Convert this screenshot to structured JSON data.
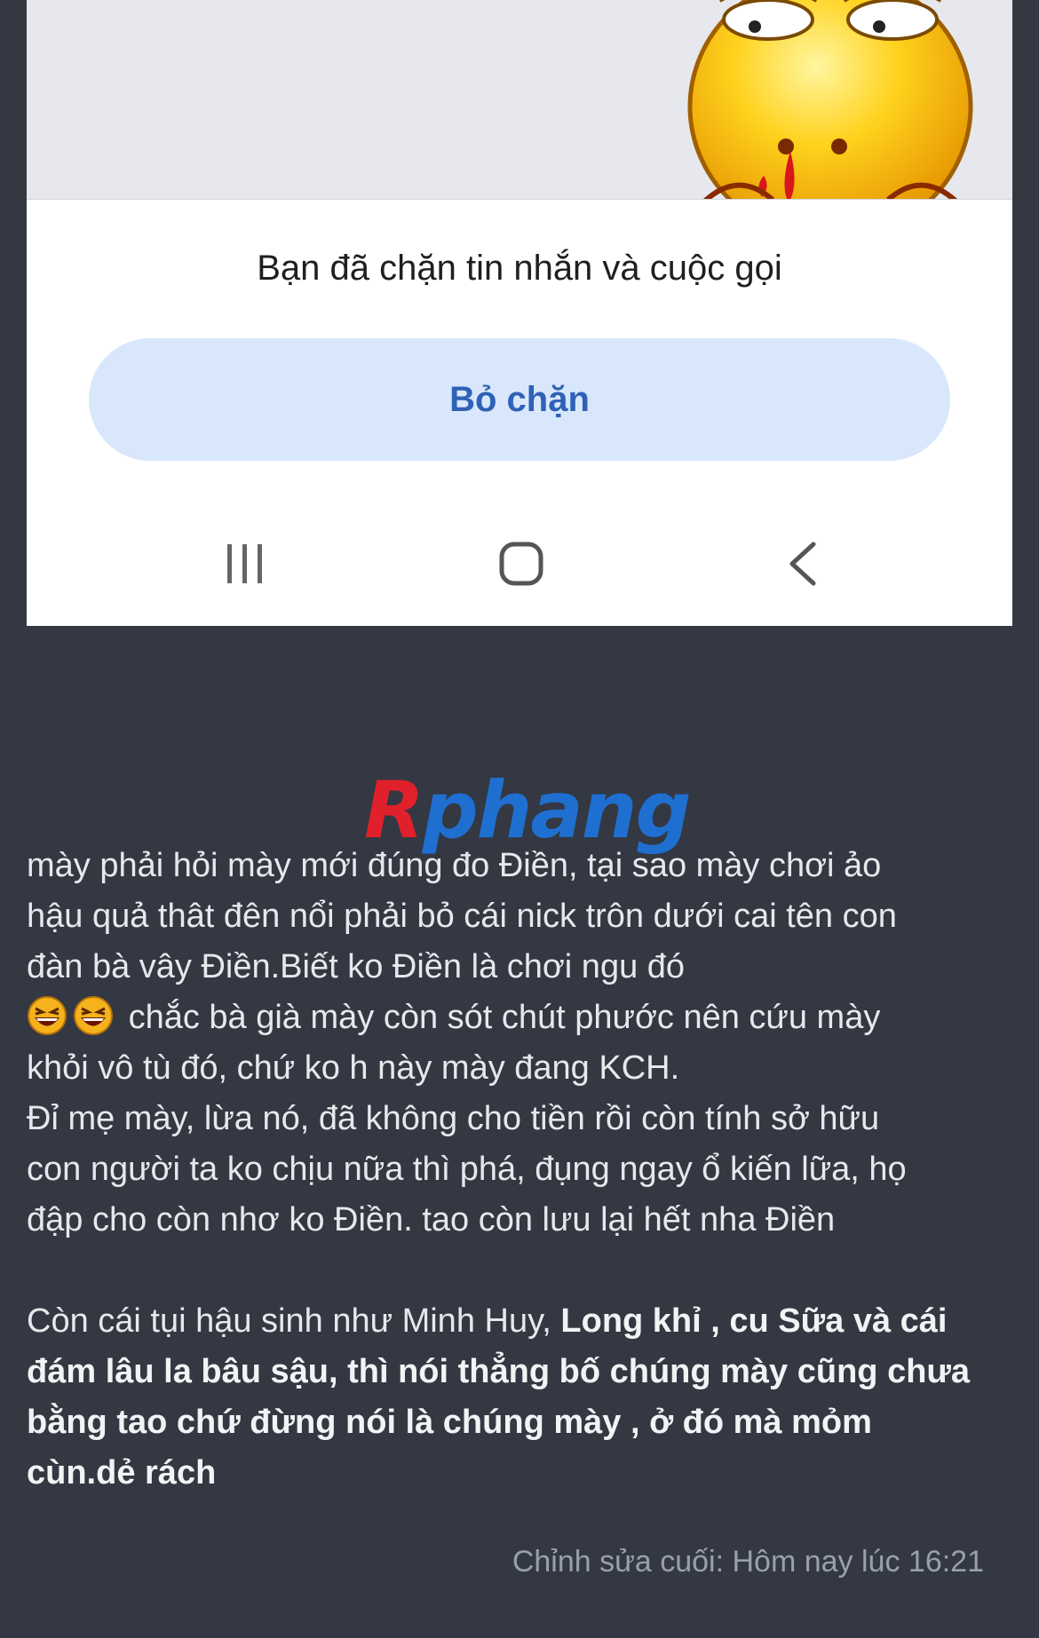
{
  "screenshot": {
    "blocked_message": "Bạn đã chặn tin nhắn và cuộc gọi",
    "unblock_label": "Bỏ chặn",
    "navbar": [
      "recents-icon",
      "home-icon",
      "back-icon"
    ]
  },
  "watermark": {
    "first": "R",
    "rest": "phang"
  },
  "post": {
    "p1_line1": "mày phải hỏi mày mới đúng đo Điền, tại sao mày chơi ảo",
    "p1_line2": "hậu quả thât đên nổi phải bỏ cái nick trôn dưới cai tên con",
    "p1_line3": "đàn bà vây Điền.Biết ko Điền là chơi ngu đó",
    "p1_line4": "chắc bà già mày còn sót chút phước nên cứu mày",
    "p1_line5": "khỏi vô tù đó, chứ ko h này mày đang KCH.",
    "p2_line1": "Đỉ mẹ mày, lừa nó, đã không cho tiền rồi còn tính sở hữu",
    "p2_line2": "con người ta ko chịu nữa thì phá, đụng ngay ổ kiến lữa, họ",
    "p2_line3": "đập cho còn nhơ ko Điền. tao còn lưu lại hết nha Điền",
    "p3_normal": "Còn cái tụi hậu sinh như Minh Huy, ",
    "p3_bold1": "Long khỉ , cu Sữa và cái",
    "p3_bold2": "đám lâu la bâu sậu, thì nói thẳng bố chúng mày cũng chưa",
    "p3_bold3": "bằng tao chứ đừng nói là chúng mày , ở đó mà mỏm",
    "p3_bold4": "cùn.dẻ rách"
  },
  "edit_note": "Chỉnh sửa cuối: Hôm nay lúc 16:21"
}
